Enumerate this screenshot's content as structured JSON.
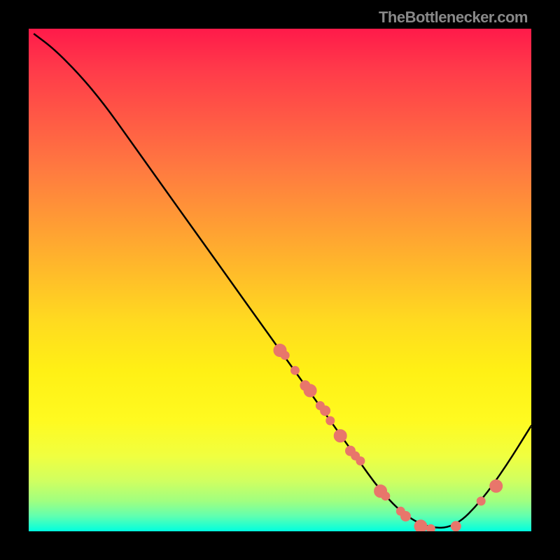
{
  "watermark": "TheBottlenecker.com",
  "chart_data": {
    "type": "line",
    "title": "",
    "xlabel": "",
    "ylabel": "",
    "xlim": [
      0,
      100
    ],
    "ylim": [
      0,
      100
    ],
    "background_gradient": {
      "top": "#ff1a4a",
      "bottom": "#00ffe0",
      "description": "vertical red-to-yellow-to-green gradient"
    },
    "series": [
      {
        "name": "bottleneck-curve",
        "type": "line",
        "x": [
          1,
          5,
          10,
          15,
          20,
          25,
          30,
          35,
          40,
          45,
          50,
          55,
          60,
          65,
          70,
          75,
          80,
          85,
          90,
          95,
          100
        ],
        "y": [
          99,
          96,
          91,
          85,
          78,
          71,
          64,
          57,
          50,
          43,
          36,
          29,
          22,
          15,
          8,
          3,
          0.5,
          1,
          6,
          13,
          21
        ]
      },
      {
        "name": "highlight-points",
        "type": "scatter",
        "x": [
          50,
          51,
          53,
          55,
          56,
          58,
          59,
          60,
          62,
          64,
          65,
          66,
          70,
          71,
          74,
          75,
          78,
          80,
          85,
          90,
          93
        ],
        "y": [
          36,
          35,
          32,
          29,
          28,
          25,
          24,
          22,
          19,
          16,
          15,
          14,
          8,
          7,
          4,
          3,
          1,
          0.5,
          1,
          6,
          9
        ]
      }
    ]
  }
}
